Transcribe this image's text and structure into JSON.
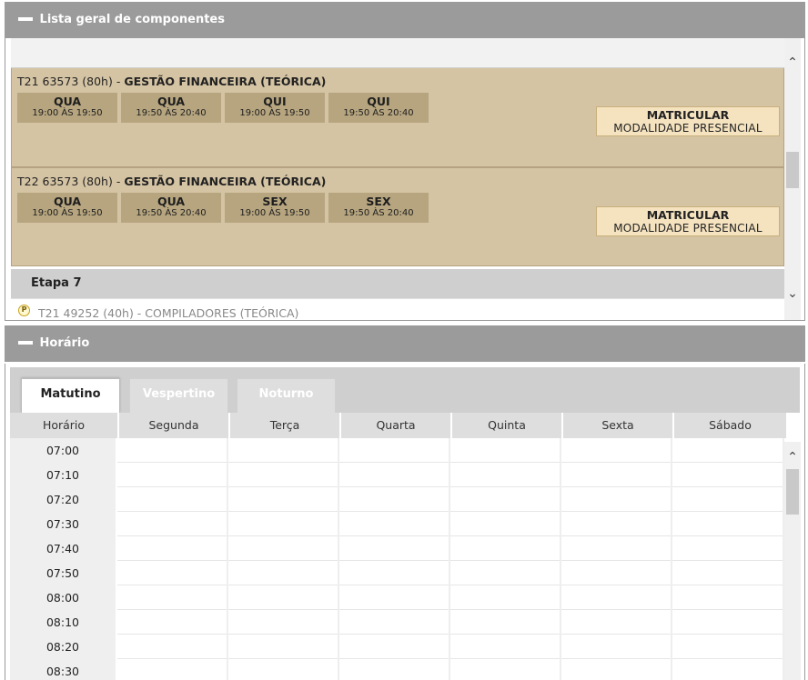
{
  "components_panel": {
    "title": "Lista geral de componentes",
    "offers": [
      {
        "code": "T21 63573 (80h)",
        "sep": " - ",
        "name": "GESTÃO FINANCEIRA (TEÓRICA)",
        "slots": [
          {
            "day": "QUA",
            "time": "19:00 ÀS 19:50"
          },
          {
            "day": "QUA",
            "time": "19:50 ÀS 20:40"
          },
          {
            "day": "QUI",
            "time": "19:00 ÀS 19:50"
          },
          {
            "day": "QUI",
            "time": "19:50 ÀS 20:40"
          }
        ],
        "enroll_label": "MATRICULAR",
        "modality": "MODALIDADE PRESENCIAL"
      },
      {
        "code": "T22 63573 (80h)",
        "sep": " - ",
        "name": "GESTÃO FINANCEIRA (TEÓRICA)",
        "slots": [
          {
            "day": "QUA",
            "time": "19:00 ÀS 19:50"
          },
          {
            "day": "QUA",
            "time": "19:50 ÀS 20:40"
          },
          {
            "day": "SEX",
            "time": "19:00 ÀS 19:50"
          },
          {
            "day": "SEX",
            "time": "19:50 ÀS 20:40"
          }
        ],
        "enroll_label": "MATRICULAR",
        "modality": "MODALIDADE PRESENCIAL"
      }
    ],
    "stage_label": "Etapa 7",
    "next_item": {
      "icon_letter": "P",
      "text": "T21 49252 (40h) - COMPILADORES (TEÓRICA)"
    }
  },
  "schedule_panel": {
    "title": "Horário",
    "tabs": [
      "Matutino",
      "Vespertino",
      "Noturno"
    ],
    "active_tab": "Matutino",
    "columns": [
      "Horário",
      "Segunda",
      "Terça",
      "Quarta",
      "Quinta",
      "Sexta",
      "Sábado"
    ],
    "times": [
      "07:00",
      "07:10",
      "07:20",
      "07:30",
      "07:40",
      "07:50",
      "08:00",
      "08:10",
      "08:20",
      "08:30"
    ]
  },
  "icons": {
    "collapse": "minus-icon",
    "scroll_up": "chevron-up-icon",
    "scroll_down": "chevron-down-icon",
    "presencial_badge": "p-circle-icon"
  },
  "colors": {
    "header_gray": "#9b9b9b",
    "offer_bg": "#d5c4a3",
    "slot_bg": "#b6a57f",
    "enroll_bg": "#f5e3c0"
  }
}
